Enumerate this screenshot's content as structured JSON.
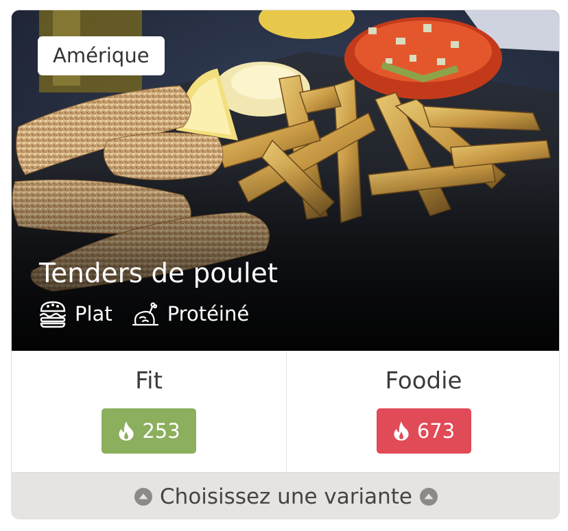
{
  "card": {
    "region": "Amérique",
    "title": "Tenders de poulet",
    "tags": [
      {
        "label": "Plat",
        "icon": "burger-icon"
      },
      {
        "label": "Protéiné",
        "icon": "roast-chicken-icon"
      }
    ]
  },
  "variants": [
    {
      "name": "Fit",
      "kcal": "253",
      "color": "#8caf5e",
      "icon": "flame-icon"
    },
    {
      "name": "Foodie",
      "kcal": "673",
      "color": "#e14a57",
      "icon": "flame-icon"
    }
  ],
  "footer": {
    "label": "Choisissez une variante",
    "icon": "triangle-up-icon"
  }
}
